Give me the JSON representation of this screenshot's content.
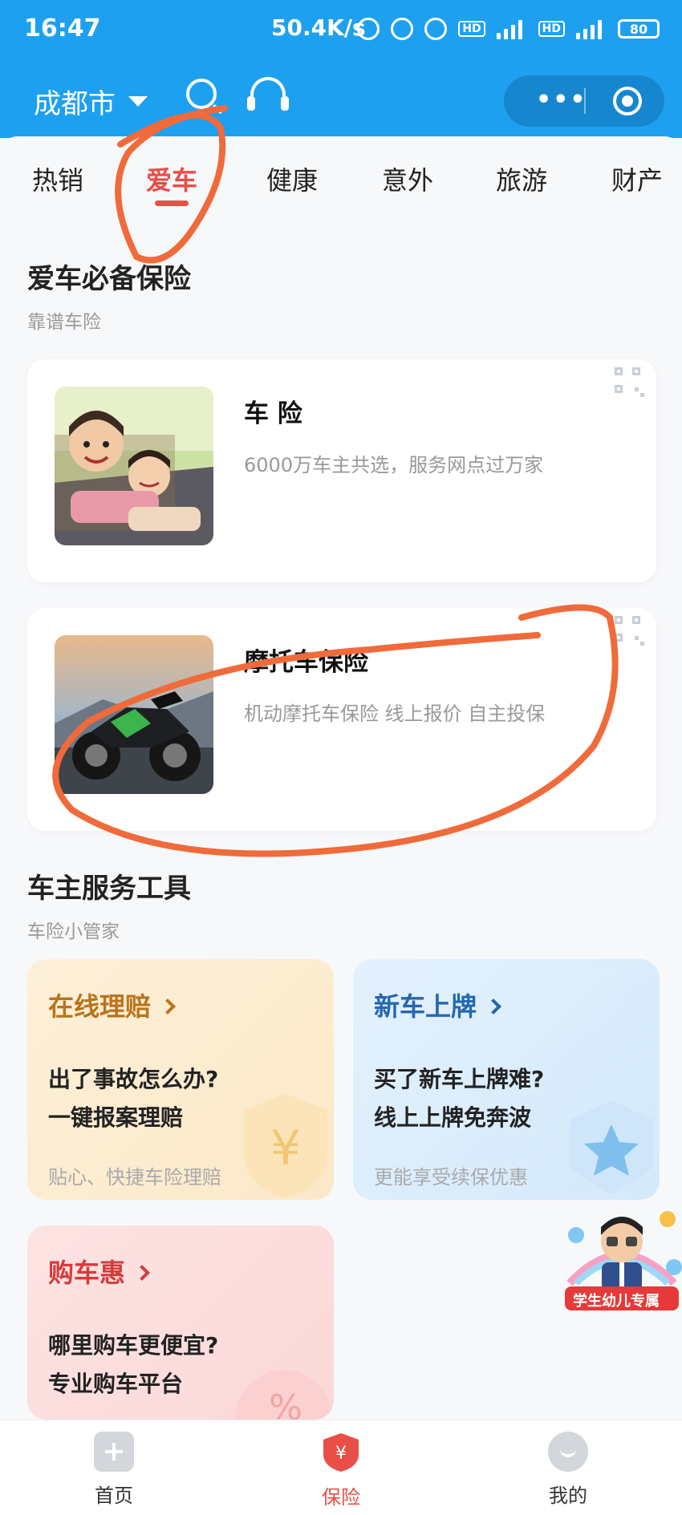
{
  "status": {
    "time": "16:47",
    "speed": "50.4K/s",
    "battery": "80"
  },
  "header": {
    "city": "成都市"
  },
  "tabs": [
    {
      "label": "热销"
    },
    {
      "label": "爱车",
      "active": true
    },
    {
      "label": "健康"
    },
    {
      "label": "意外"
    },
    {
      "label": "旅游"
    },
    {
      "label": "财产"
    }
  ],
  "section1": {
    "title": "爱车必备保险",
    "subtitle": "靠谱车险"
  },
  "products": [
    {
      "title": "车 险",
      "desc": "6000万车主共选，服务网点过万家"
    },
    {
      "title": "摩托车保险",
      "desc": "机动摩托车保险 线上报价 自主投保"
    }
  ],
  "section2": {
    "title": "车主服务工具",
    "subtitle": "车险小管家"
  },
  "services": [
    {
      "title": "在线理赔",
      "line1": "出了事故怎么办?",
      "line2": "一键报案理赔",
      "foot": "贴心、快捷车险理赔",
      "color": "#b8741c"
    },
    {
      "title": "新车上牌",
      "line1": "买了新车上牌难?",
      "line2": "线上上牌免奔波",
      "foot": "更能享受续保优惠",
      "color": "#2467b0"
    },
    {
      "title": "购车惠",
      "line1": "哪里购车更便宜?",
      "line2": "专业购车平台",
      "foot": "",
      "color": "#d63b3b"
    }
  ],
  "promo": {
    "label": "学生幼儿专属"
  },
  "bottom_nav": [
    {
      "label": "首页",
      "icon": "home-icon"
    },
    {
      "label": "保险",
      "icon": "insurance-shield-icon",
      "active": true
    },
    {
      "label": "我的",
      "icon": "profile-icon"
    }
  ]
}
